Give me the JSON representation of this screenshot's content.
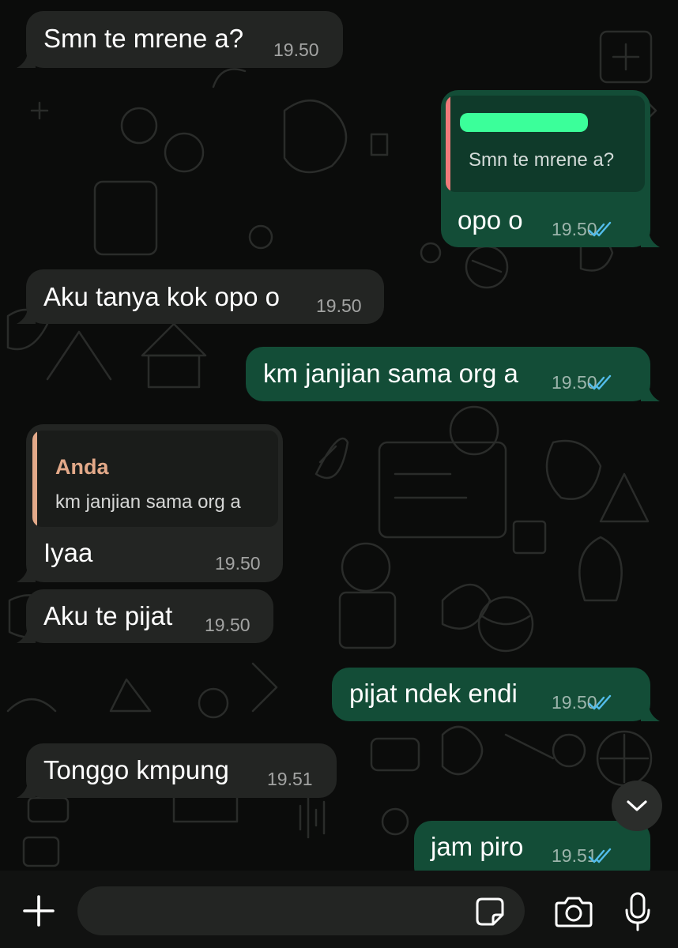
{
  "messages": [
    {
      "direction": "in",
      "text": "Smn te mrene a?",
      "time": "19.50"
    },
    {
      "direction": "out",
      "text": "opo o",
      "time": "19.50",
      "read": true,
      "quote": {
        "author_redacted": true,
        "text": "Smn te mrene a?"
      }
    },
    {
      "direction": "in",
      "text": "Aku tanya kok opo o",
      "time": "19.50"
    },
    {
      "direction": "out",
      "text": "km janjian sama org a",
      "time": "19.50",
      "read": true
    },
    {
      "direction": "in",
      "text": "Iyaa",
      "time": "19.50",
      "quote": {
        "author": "Anda",
        "text": "km janjian sama org a"
      }
    },
    {
      "direction": "in",
      "text": "Aku te pijat",
      "time": "19.50"
    },
    {
      "direction": "out",
      "text": "pijat ndek endi",
      "time": "19.50",
      "read": true
    },
    {
      "direction": "in",
      "text": "Tonggo kmpung",
      "time": "19.51"
    },
    {
      "direction": "out",
      "text": "jam piro",
      "time": "19.51",
      "read": true
    }
  ],
  "input": {
    "placeholder": ""
  },
  "icons": {
    "attach": "plus-icon",
    "sticker": "sticker-icon",
    "camera": "camera-icon",
    "mic": "microphone-icon",
    "scroll": "chevron-down-icon",
    "read": "double-check-icon"
  },
  "colors": {
    "incoming_bubble": "#232523",
    "outgoing_bubble": "#134d37",
    "read_ticks": "#53bdeb",
    "quote_bar_mine": "#f07a7a",
    "quote_bar_anda": "#e3a989",
    "quote_author_anda": "#e3a989",
    "redaction": "#3bff9a"
  }
}
